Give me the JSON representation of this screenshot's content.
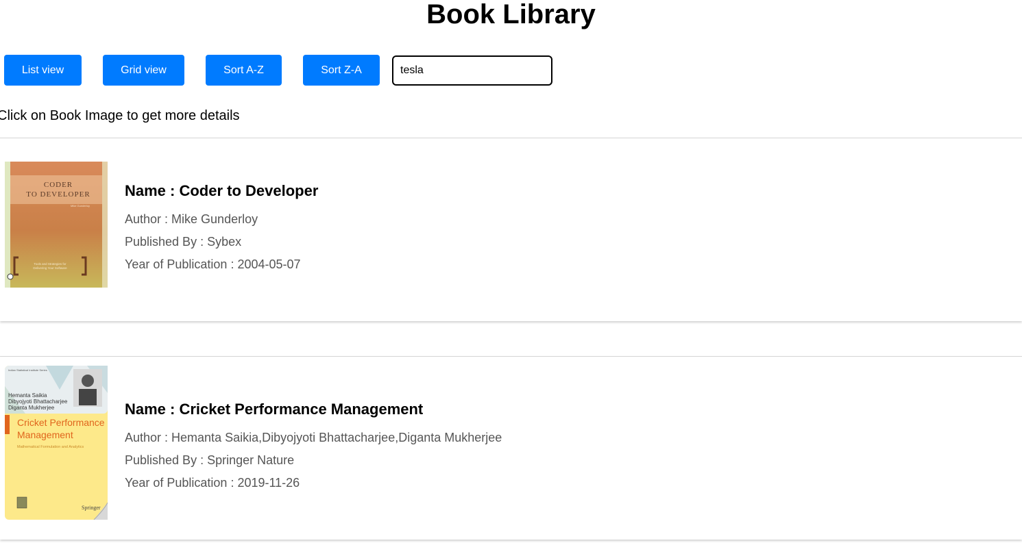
{
  "page": {
    "title": "Book Library",
    "hint": "Click on Book Image to get more details"
  },
  "toolbar": {
    "list_view": "List view",
    "grid_view": "Grid view",
    "sort_az": "Sort A-Z",
    "sort_za": "Sort Z-A",
    "search_value": "tesla"
  },
  "books": [
    {
      "name": "Name : Coder to Developer",
      "author": "Author : Mike Gunderloy",
      "publisher": "Published By : Sybex",
      "year": "Year of Publication : 2004-05-07",
      "cover": {
        "title_line1": "CODER",
        "title_line2": "TO DEVELOPER",
        "author": "Mike Gunderloy",
        "tagline1": "Tools and Strategies for",
        "tagline2": "Delivering Your Software",
        "colors": {
          "top": "#d98a5a",
          "bottom": "#c8b85a",
          "edge": "#dfe8c0"
        }
      }
    },
    {
      "name": "Name : Cricket Performance Management",
      "author": "Author : Hemanta Saikia,Dibyojyoti Bhattacharjee,Diganta Mukherjee",
      "publisher": "Published By : Springer Nature",
      "year": "Year of Publication : 2019-11-26",
      "cover": {
        "series": "Indian Statistical Institute Series",
        "author1": "Hemanta Saikia",
        "author2": "Dibyojyoti Bhattacharjee",
        "author3": "Diganta Mukherjee",
        "title_line1": "Cricket Performance",
        "title_line2": "Management",
        "subtitle": "Mathematical Formulation and Analytics",
        "publisher": "Springer",
        "colors": {
          "bg": "#fde98a",
          "title": "#e0651d",
          "accent": "#e0651d"
        }
      }
    }
  ],
  "colors": {
    "button": "#007bff",
    "meta_text": "#555555"
  }
}
